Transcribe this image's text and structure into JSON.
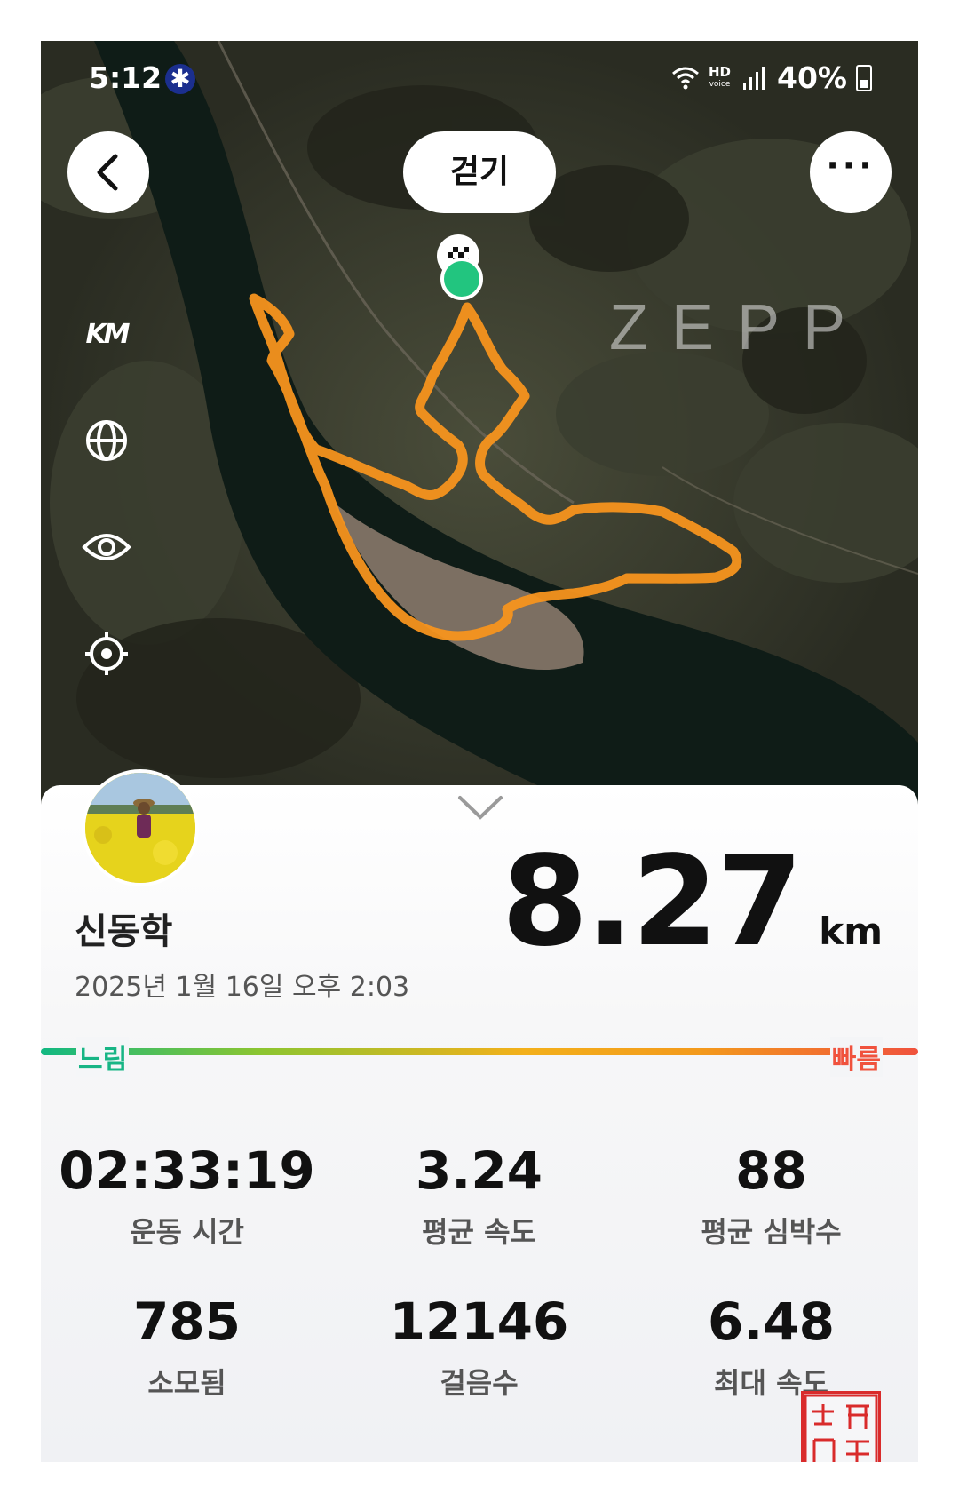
{
  "status_bar": {
    "time": "5:12",
    "hd_label": "HD",
    "voice_label": "voice",
    "battery": "40%"
  },
  "map": {
    "activity_type": "걷기",
    "watermark": "ZEPP",
    "unit_toggle": "KM"
  },
  "summary": {
    "user_name": "신동학",
    "datetime": "2025년 1월 16일 오후 2:03",
    "distance": "8.27",
    "distance_unit": "km",
    "pace_slow": "느림",
    "pace_fast": "빠름"
  },
  "stats": [
    {
      "value": "02:33:19",
      "label": "운동 시간"
    },
    {
      "value": "3.24",
      "label": "평균 속도"
    },
    {
      "value": "88",
      "label": "평균 심박수"
    },
    {
      "value": "785",
      "label": "소모됨"
    },
    {
      "value": "12146",
      "label": "걸음수"
    },
    {
      "value": "6.48",
      "label": "최대 속도"
    }
  ],
  "colors": {
    "route": "#f7941d",
    "start_marker": "#22c57f",
    "slow": "#17b585",
    "fast": "#f0523d",
    "seal": "#d92b2b"
  }
}
